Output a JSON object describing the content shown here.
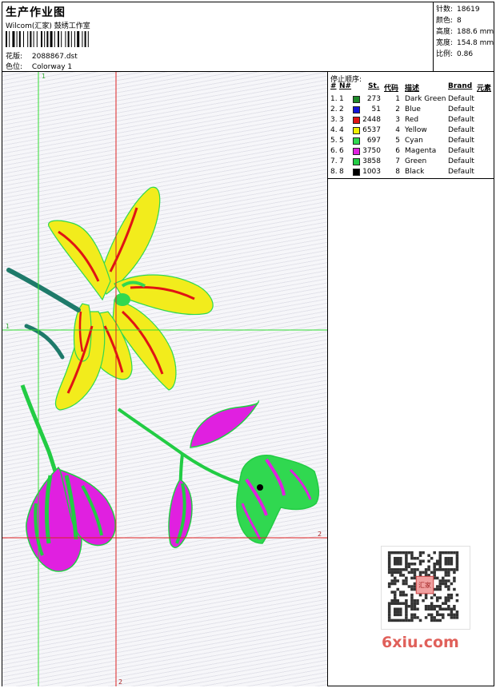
{
  "header": {
    "title": "生产作业图",
    "company": "Wilcom(汇家) 鼓绣工作室",
    "design_label": "花版:",
    "design_value": "2088867.dst",
    "colorway_label": "色位:",
    "colorway_value": "Colorway 1"
  },
  "stats": [
    {
      "label": "针数:",
      "value": "18619"
    },
    {
      "label": "颜色:",
      "value": "8"
    },
    {
      "label": "高度:",
      "value": "188.6 mm"
    },
    {
      "label": "宽度:",
      "value": "154.8 mm"
    },
    {
      "label": "比例:",
      "value": "0.86"
    }
  ],
  "stop_sequence": {
    "title": "停止顺序:",
    "columns": [
      "#",
      "N#",
      "St.",
      "代码",
      "描述",
      "Brand",
      "元素"
    ],
    "rows": [
      {
        "idx": "1.",
        "n": "1",
        "color": "#1e8a2a",
        "st": "273",
        "code": "1",
        "desc": "Dark Green",
        "brand": "Default"
      },
      {
        "idx": "2.",
        "n": "2",
        "color": "#1414d8",
        "st": "51",
        "code": "2",
        "desc": "Blue",
        "brand": "Default"
      },
      {
        "idx": "3.",
        "n": "3",
        "color": "#e01414",
        "st": "2448",
        "code": "3",
        "desc": "Red",
        "brand": "Default"
      },
      {
        "idx": "4.",
        "n": "4",
        "color": "#f0f000",
        "st": "6537",
        "code": "4",
        "desc": "Yellow",
        "brand": "Default"
      },
      {
        "idx": "5.",
        "n": "5",
        "color": "#30d850",
        "st": "697",
        "code": "5",
        "desc": "Cyan",
        "brand": "Default"
      },
      {
        "idx": "6.",
        "n": "6",
        "color": "#e020e0",
        "st": "3750",
        "code": "6",
        "desc": "Magenta",
        "brand": "Default"
      },
      {
        "idx": "7.",
        "n": "7",
        "color": "#22cc44",
        "st": "3858",
        "code": "7",
        "desc": "Green",
        "brand": "Default"
      },
      {
        "idx": "8.",
        "n": "8",
        "color": "#000000",
        "st": "1003",
        "code": "8",
        "desc": "Black",
        "brand": "Default"
      }
    ]
  },
  "guides": {
    "label_1": "1",
    "label_2": "2",
    "green_color": "#33dd33",
    "red_color": "#dd2222"
  },
  "watermark": {
    "text": "6xiu.com",
    "qr_badge": "汇家"
  }
}
